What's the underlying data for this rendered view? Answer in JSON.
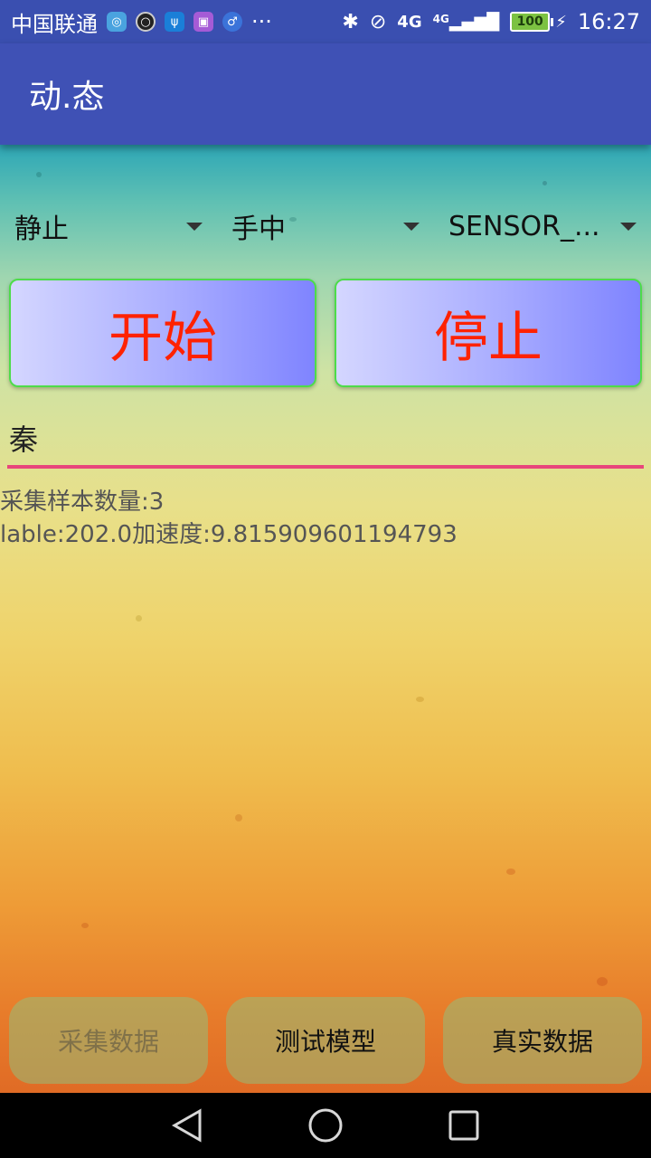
{
  "status_bar": {
    "carrier": "中国联通",
    "more": "···",
    "network": "4G",
    "network2": "4G",
    "battery": "100",
    "time": "16:27"
  },
  "app_bar": {
    "title": "动.态"
  },
  "spinners": [
    {
      "value": "静止"
    },
    {
      "value": "手中"
    },
    {
      "value": "SENSOR_..."
    }
  ],
  "buttons": {
    "start": "开始",
    "stop": "停止"
  },
  "edit": {
    "value": "秦"
  },
  "info": {
    "sample_count": "采集样本数量:3",
    "reading": "lable:202.0加速度:9.815909601194793"
  },
  "bottom_buttons": {
    "collect": "采集数据",
    "test": "测试模型",
    "real": "真实数据"
  },
  "colors": {
    "app_bar": "#3f51b5",
    "button_text": "#ff2200",
    "button_border": "#4ddc4a",
    "edit_underline": "#e8467b"
  }
}
